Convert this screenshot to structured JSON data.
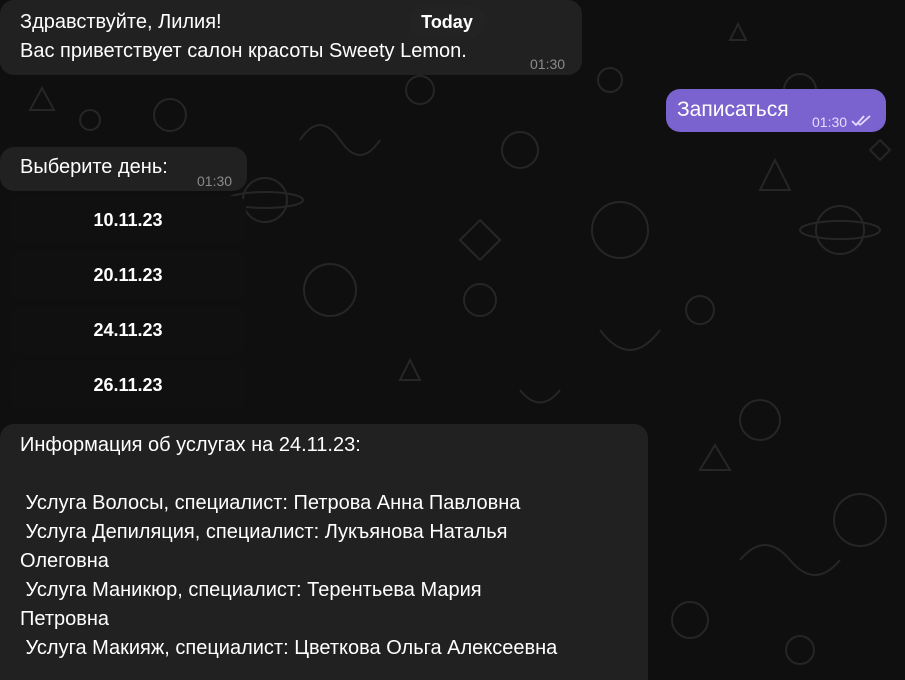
{
  "date_separator": "Today",
  "messages": {
    "greeting": {
      "line1": "Здравствуйте, Лилия!",
      "line2": "Вас приветствует салон красоты Sweety Lemon.",
      "time": "01:30"
    },
    "user_reply": {
      "text": "Записаться",
      "time": "01:30",
      "status": "double-check-icon"
    },
    "choose_day": {
      "text": "Выберите день:",
      "time": "01:30"
    },
    "services_info": {
      "title": "Информация об услугах на 24.11.23:",
      "lines": [
        " Услуга Волосы, специалист: Петрова Анна Павловна",
        " Услуга Депиляция, специалист: Лукъянова Наталья",
        "Олеговна",
        " Услуга Маникюр, специалист: Терентьева Мария",
        "Петровна",
        " Услуга Макияж, специалист: Цветкова Ольга Алексеевна"
      ]
    }
  },
  "day_buttons": [
    "10.11.23",
    "20.11.23",
    "24.11.23",
    "26.11.23"
  ],
  "colors": {
    "background": "#0f0f0f",
    "incoming_bubble": "#212121",
    "outgoing_bubble": "#7b63cf",
    "keyboard_button": "#101010",
    "doodle_stroke": "#2a2a2a"
  }
}
